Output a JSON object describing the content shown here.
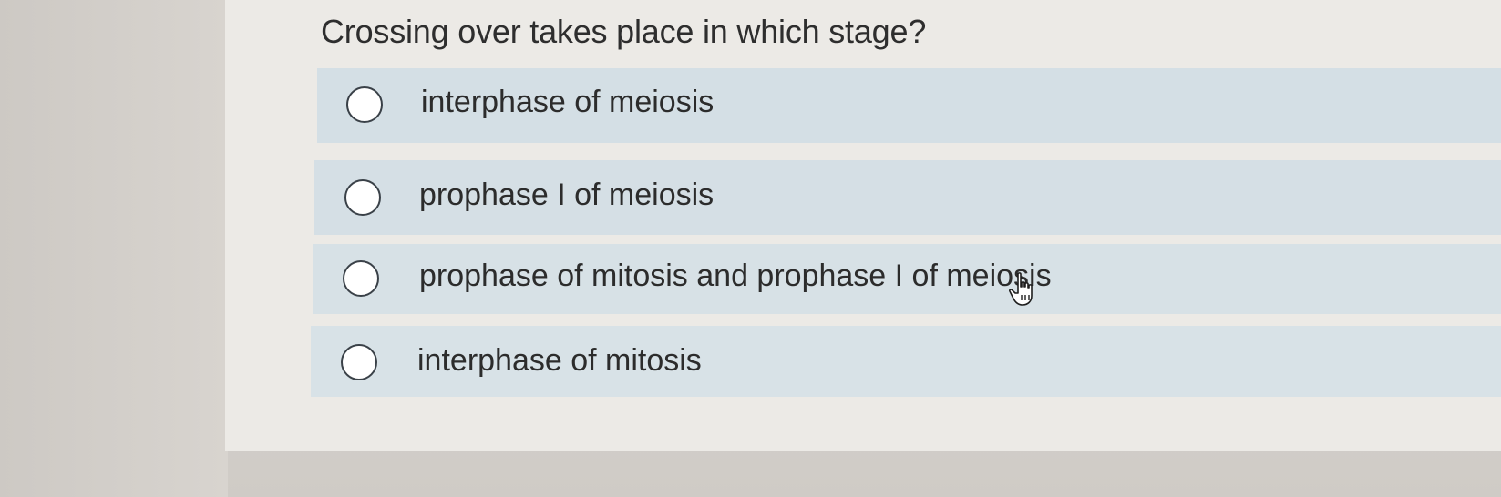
{
  "question": {
    "text": "Crossing over takes place in which stage?"
  },
  "choices": [
    {
      "label": "interphase of meiosis",
      "selected": false
    },
    {
      "label": "prophase I of meiosis",
      "selected": false
    },
    {
      "label": "prophase of mitosis and prophase I of meiosis",
      "selected": false
    },
    {
      "label": "interphase of mitosis",
      "selected": false
    }
  ],
  "cursor": {
    "icon": "hand-pointer-icon"
  },
  "colors": {
    "choice_background": "#d5e0e6",
    "radio_border": "#3a4148",
    "text": "#2c2c2c"
  }
}
